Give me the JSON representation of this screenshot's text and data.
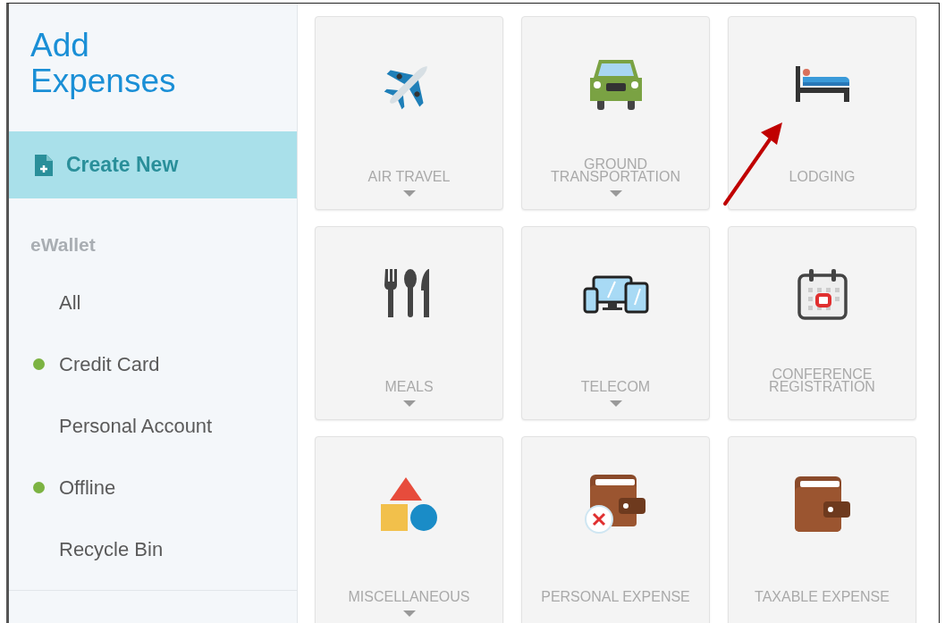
{
  "sidebar": {
    "title": "Add Expenses",
    "create_button": "Create New",
    "section": "eWallet",
    "items": [
      {
        "label": "All"
      },
      {
        "label": "Credit Card",
        "color": "#7cb342"
      },
      {
        "label": "Personal Account"
      },
      {
        "label": "Offline",
        "color": "#7cb342"
      },
      {
        "label": "Recycle Bin"
      }
    ]
  },
  "tiles": [
    {
      "kind": "plane",
      "label": "AIR TRAVEL",
      "dropdown": true
    },
    {
      "kind": "car",
      "label": "GROUND TRANSPORTATION",
      "dropdown": true
    },
    {
      "kind": "bed",
      "label": "LODGING",
      "dropdown": false
    },
    {
      "kind": "meals",
      "label": "MEALS",
      "dropdown": true
    },
    {
      "kind": "devices",
      "label": "TELECOM",
      "dropdown": true
    },
    {
      "kind": "calendar",
      "label": "CONFERENCE REGISTRATION",
      "dropdown": false
    },
    {
      "kind": "shapes",
      "label": "MISCELLANEOUS",
      "dropdown": true
    },
    {
      "kind": "wallet-x",
      "label": "PERSONAL EXPENSE",
      "dropdown": false
    },
    {
      "kind": "wallet",
      "label": "TAXABLE EXPENSE",
      "dropdown": false
    }
  ]
}
